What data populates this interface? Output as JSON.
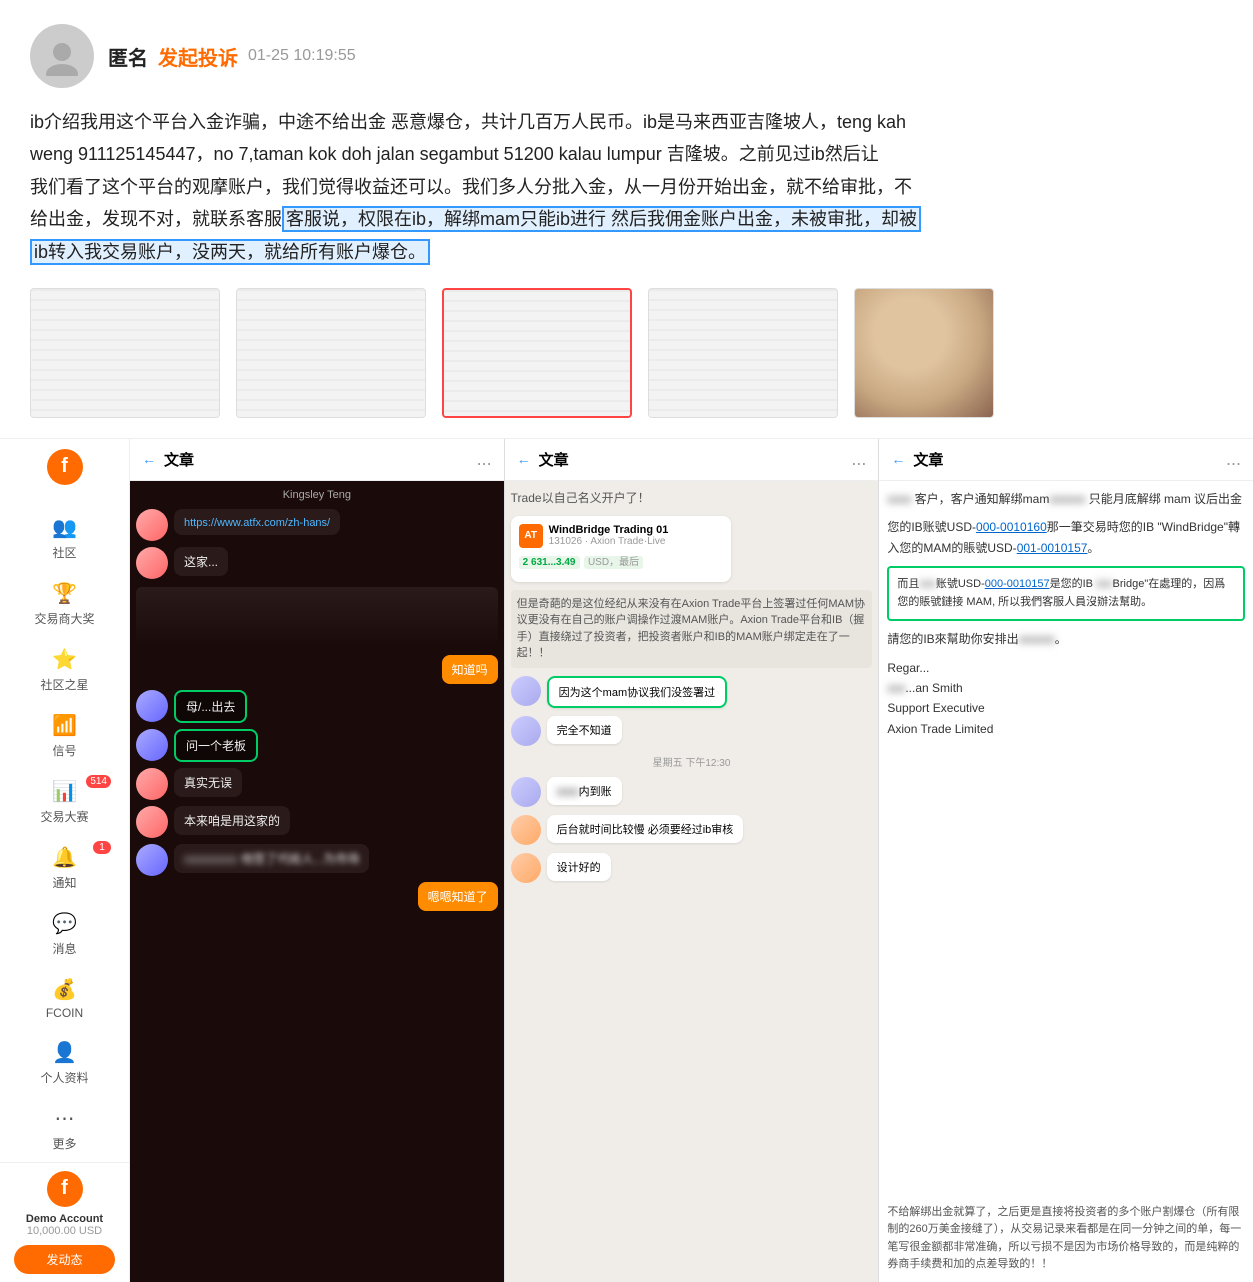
{
  "complaint": {
    "user": "匿名",
    "tag": "发起投诉",
    "timestamp": "01-25 10:19:55",
    "body_lines": [
      "ib介绍我用这个平台入金诈骗，中途不给出金 恶意爆仓，共计几百万人民币。ib是马来西亚吉隆坡人，teng kah",
      "weng 911125145447，no 7,taman kok doh jalan segambut 51200 kalau lumpur 吉隆坡。之前见过ib然后让",
      "我们看了这个平台的观摩账户，我们觉得收益还可以。我们多人分批入金，从一月份开始出金，就不给审批，不",
      "给出金，发现不对，就联系客服"
    ],
    "highlighted_text": "客服说，权限在ib，解绑mam只能ib进行 然后我佣金账户出金，未被审批，却被",
    "body_line2": "ib转入我交易账户，没两天，就给所有账户爆仓。",
    "images_count": 4
  },
  "sidebar": {
    "logo": "f",
    "items": [
      {
        "icon": "👥",
        "label": "社区",
        "badge": ""
      },
      {
        "icon": "🏆",
        "label": "交易商大奖",
        "badge": ""
      },
      {
        "icon": "⭐",
        "label": "社区之星",
        "badge": ""
      },
      {
        "icon": "📶",
        "label": "信号",
        "badge": ""
      },
      {
        "icon": "📊",
        "label": "交易大赛",
        "badge": "514"
      },
      {
        "icon": "🔔",
        "label": "通知",
        "badge": "1"
      },
      {
        "icon": "💬",
        "label": "消息",
        "badge": ""
      },
      {
        "icon": "💰",
        "label": "FCOIN",
        "badge": ""
      },
      {
        "icon": "👤",
        "label": "个人资料",
        "badge": ""
      },
      {
        "icon": "⋯",
        "label": "更多",
        "badge": ""
      }
    ],
    "account": {
      "name": "Demo Account",
      "balance": "10,000.00 USD",
      "btn": "发动态"
    }
  },
  "col1": {
    "header_back": "←",
    "header_title": "文章",
    "header_more": "...",
    "chat_name": "Kingsley Teng",
    "link": "https://www.atfx.com/zh-hans/",
    "msg1": "这家...",
    "msg2": "知道吗",
    "msg3": "母/...出去",
    "msg4": "问一个老板",
    "msg5": "真实无误",
    "msg6": "本来咱是用这家的",
    "msg7": "他签了代给人...为市场",
    "msg8": "嗯嗯知道了"
  },
  "col2": {
    "header_back": "←",
    "header_title": "文章",
    "header_more": "...",
    "subtitle": "Trade以自己名义开户了！",
    "card_name": "WindBridge Trading 01",
    "card_id": "131026 · Axion Trade·Live",
    "card_amount": "2 631...3.49",
    "card_currency": "USD，最后",
    "notice": "但是奇葩的是这位经纪从来没有在Axion Trade平台上签署过任何MAM协议更没有在自己的账户调操作过渡MAM账户。Axion Trade平台和IB（握手）直接绕过了投资者，把投资者账户和IB的MAM账户绑定走在了一起！！",
    "msg1": "因为这个mam协议我们没签署过",
    "msg2": "完全不知道",
    "timestamp": "星期五 下午12:30",
    "msg3": "之前出...内到账",
    "msg4": "后台就时间比较慢 必须要经过ib审核",
    "msg5": "设计好的"
  },
  "col3": {
    "header_back": "←",
    "header_title": "文章",
    "header_more": "...",
    "intro": "...客户，客户通知解绑mam... 只能月底解绑 mam 议后出金",
    "content1": "您的IB账號USD-",
    "link1": "000-0010160",
    "content2": "那一筆交易時您的IB \"WindBridge\"轉入您的MAM的賬號USD-",
    "link2": "001-0010157",
    "box_text": "而且...账號USD-000-0010157是您的IB ...Bridge\"在處理的，因爲您的賬號鏈接 MAM, 所以我們客服人員沒辦法幫助。",
    "content3": "請您的IB來幫助你安排出...",
    "regar": "Regar...",
    "smith": "...an Smith",
    "support": "Support Executive",
    "axion": "Axion Trade Limited",
    "footer": "不给解绑出金就算了，之后更是直接将投资者的多个账户割爆仓（所有限制的260万美金接缝了），从交易记录来看都是在同一分钟之间的单，每一笔写很金额都非常准确，所以亏损不是因为市场价格导致的，而是纯粹的券商手续费和加的点差导致的！！"
  }
}
